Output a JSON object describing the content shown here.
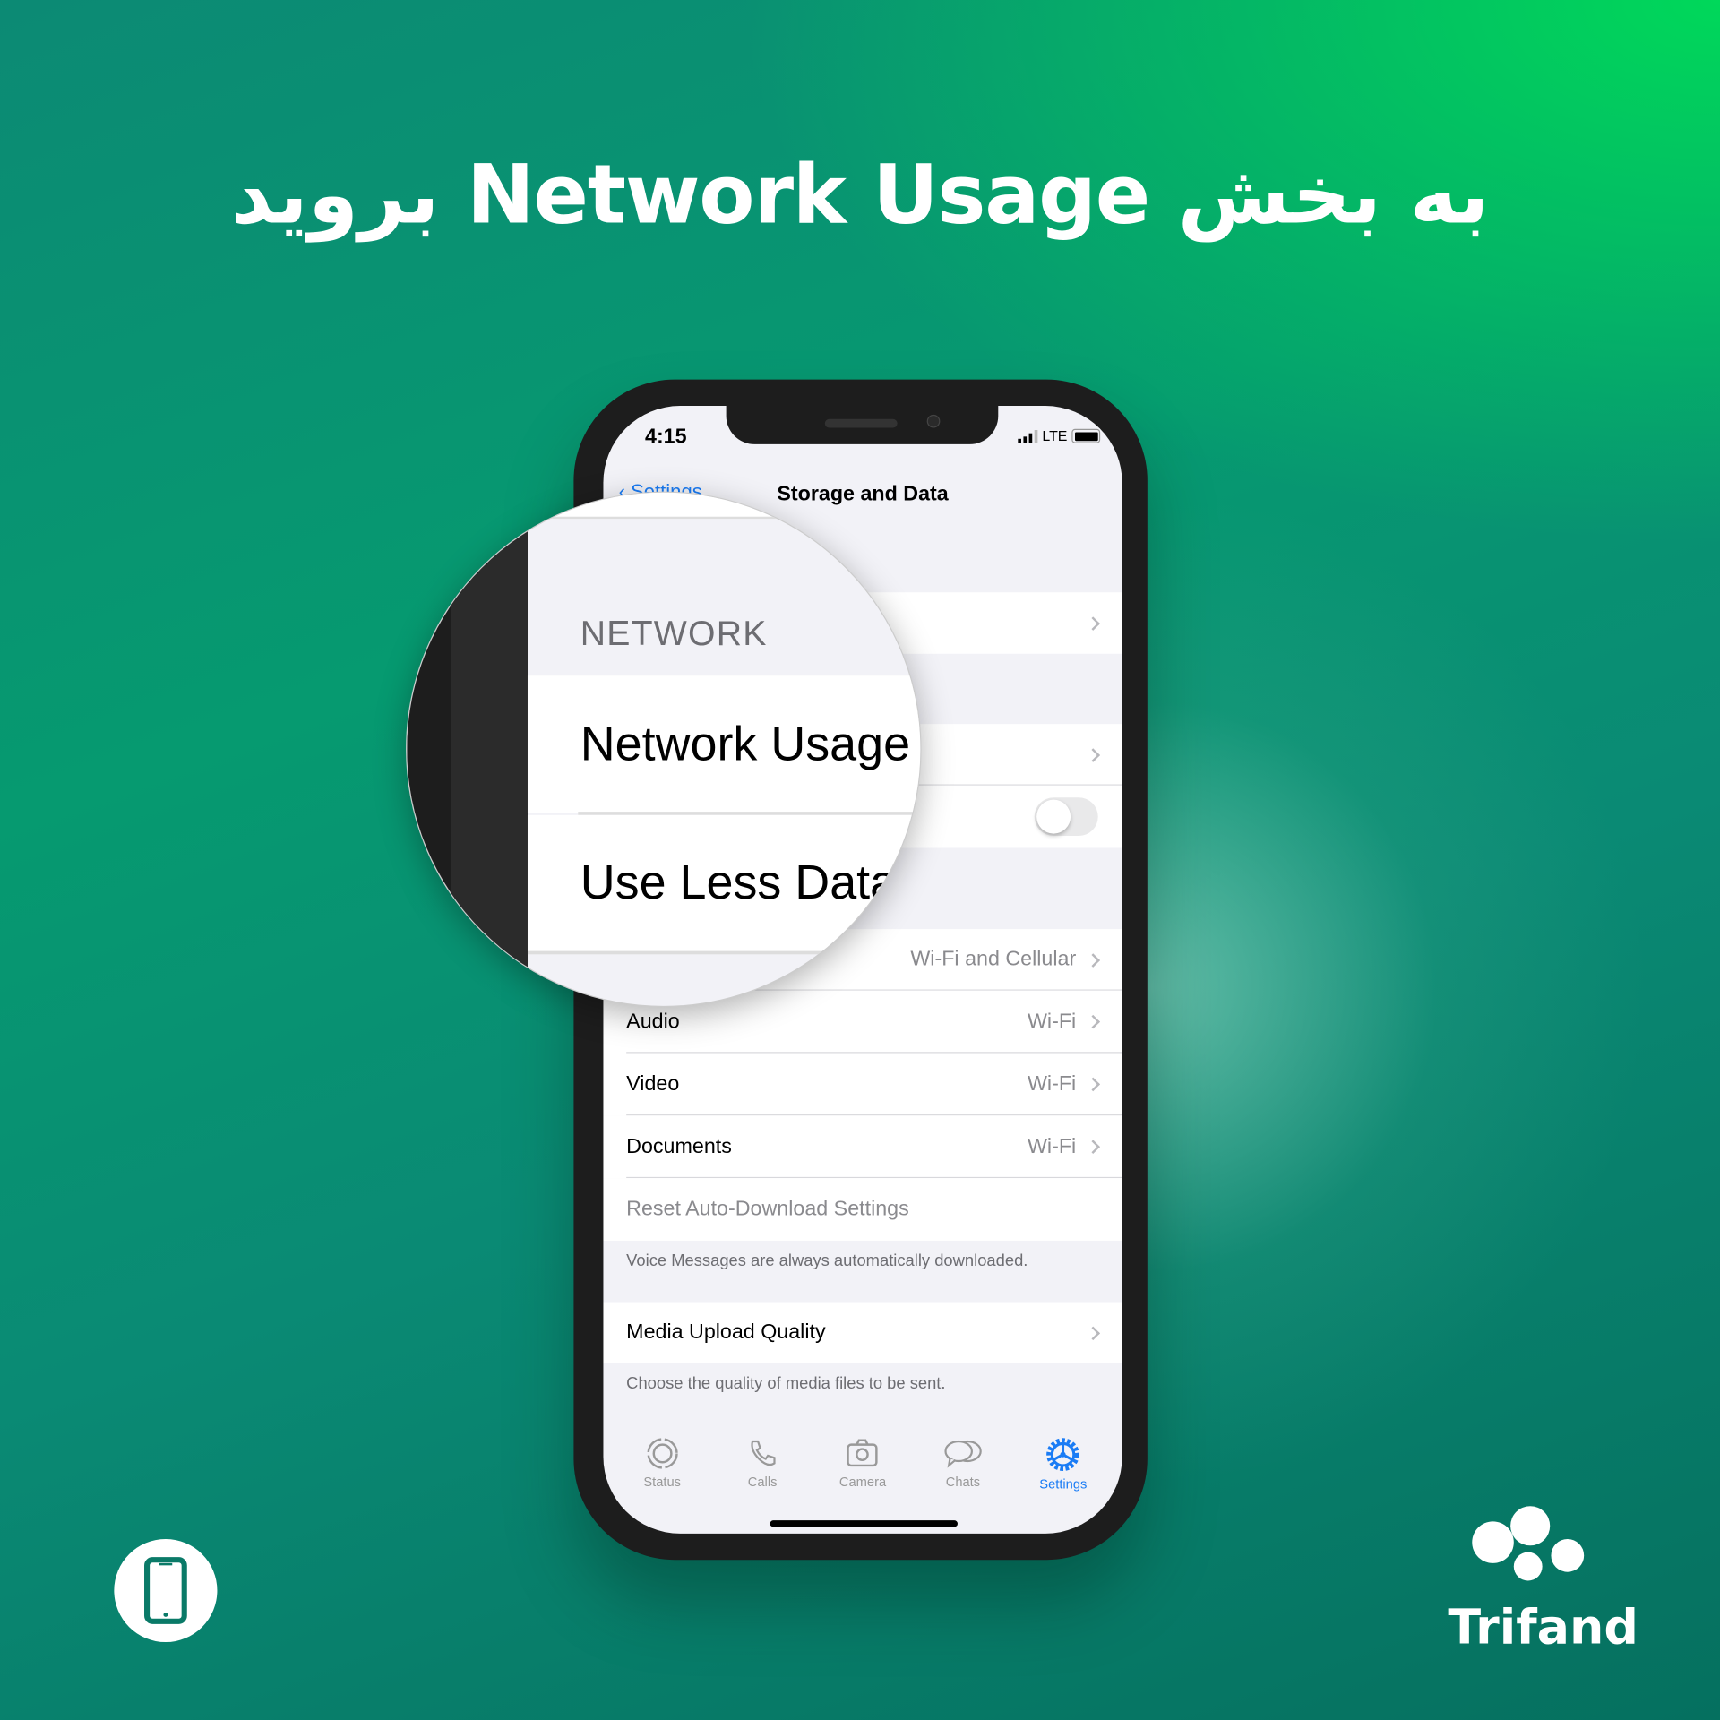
{
  "headline": "به بخش Network Usage بروید",
  "phone": {
    "status_bar": {
      "time": "4:15",
      "network": "LTE"
    },
    "nav": {
      "back_label": "Settings",
      "title": "Storage and Data"
    },
    "rows": [
      {
        "value": "Wi-Fi and Cellular"
      },
      {
        "label": "Audio",
        "value": "Wi-Fi"
      },
      {
        "label": "Video",
        "value": "Wi-Fi"
      },
      {
        "label": "Documents",
        "value": "Wi-Fi"
      }
    ],
    "reset_label": "Reset Auto-Download Settings",
    "voice_footer": "Voice Messages are always automatically downloaded.",
    "media_upload_label": "Media Upload Quality",
    "media_footer": "Choose the quality of media files to be sent.",
    "use_less_data_on": false,
    "tabs": [
      {
        "label": "Status",
        "icon": "status-icon"
      },
      {
        "label": "Calls",
        "icon": "phone-icon"
      },
      {
        "label": "Camera",
        "icon": "camera-icon"
      },
      {
        "label": "Chats",
        "icon": "chats-icon"
      },
      {
        "label": "Settings",
        "icon": "gear-icon",
        "active": true
      }
    ]
  },
  "magnifier": {
    "section_header": "NETWORK",
    "network_usage": "Network Usage",
    "use_less_data": "Use Less Data"
  },
  "brand": {
    "name": "Trifand"
  },
  "colors": {
    "accent": "#1a7cf5",
    "background": "#0a8a74",
    "bright_green": "#00d85a"
  }
}
